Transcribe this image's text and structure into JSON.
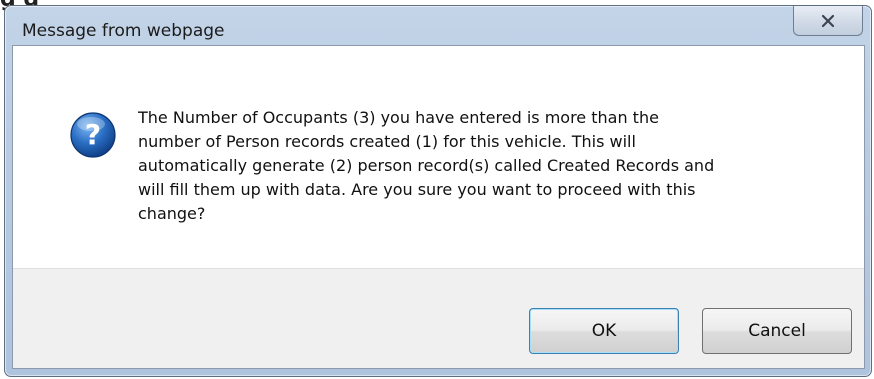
{
  "background": {
    "partial_text": "g            g"
  },
  "dialog": {
    "title": "Message from webpage",
    "close_icon": "close-x-icon",
    "icon": "question-icon",
    "message": "The Number of Occupants (3) you have entered is more than the\nnumber of Person records created (1) for this vehicle.  This will\nautomatically generate (2) person record(s) called Created Records and\nwill fill them up with data. Are you sure you want to proceed with this\nchange?",
    "buttons": {
      "ok_label": "OK",
      "cancel_label": "Cancel"
    }
  },
  "colors": {
    "title_bar": "#b8cbe2",
    "button_area": "#f0f0f0",
    "icon_blue": "#1f5fb0"
  }
}
